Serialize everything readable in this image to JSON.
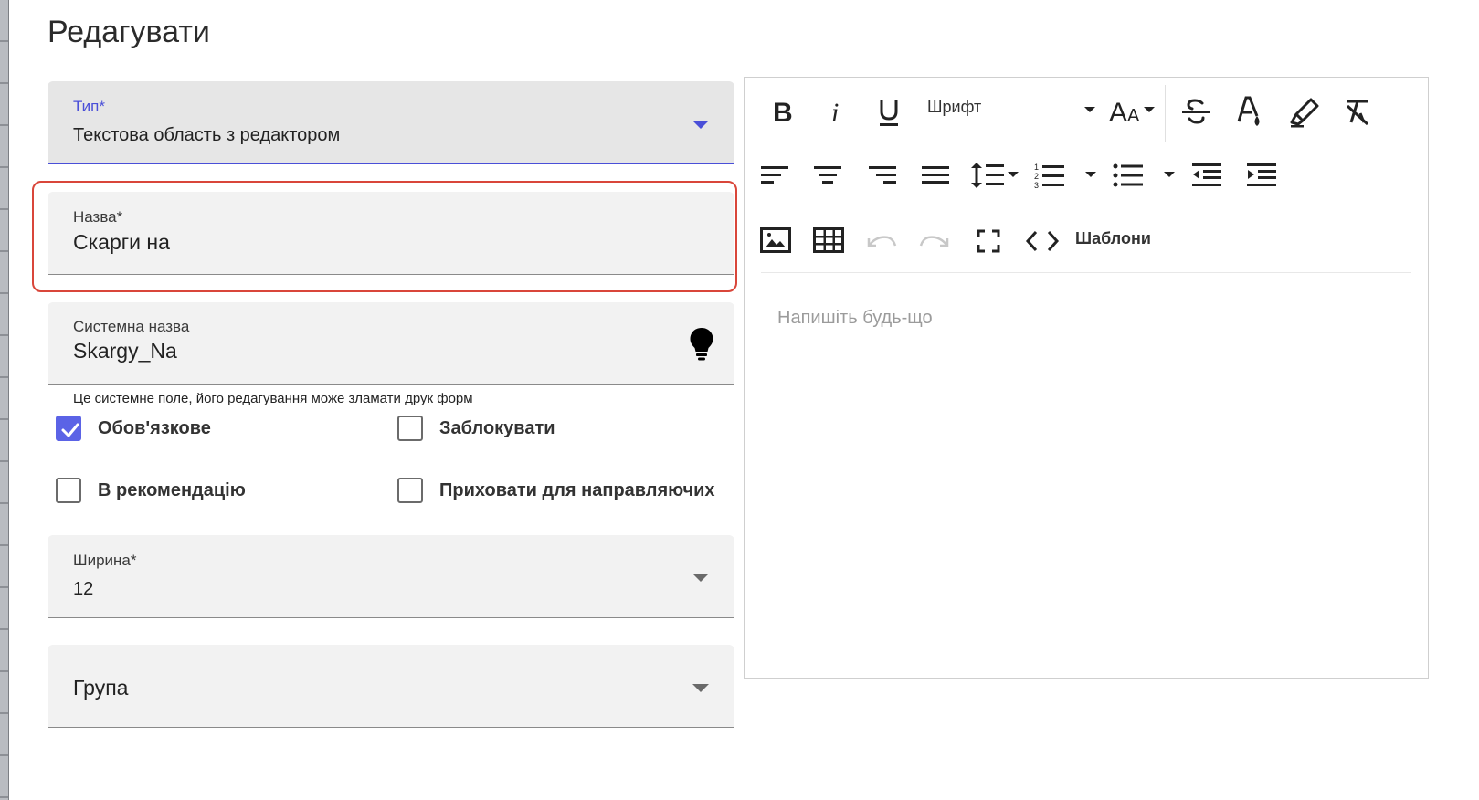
{
  "dialog": {
    "title": "Редагувати"
  },
  "form": {
    "type": {
      "label": "Тип*",
      "value": "Текстова область з редактором"
    },
    "name": {
      "label": "Назва*",
      "value": "Скарги на"
    },
    "system_name": {
      "label": "Системна назва",
      "value": "Skargy_Na",
      "icon": "lightbulb-icon"
    },
    "hint": "Це системне поле, його редагування може зламати друк форм",
    "checkboxes": {
      "required": {
        "label": "Обов'язкове",
        "checked": true
      },
      "lock": {
        "label": "Заблокувати",
        "checked": false
      },
      "recommend": {
        "label": "В рекомендацію",
        "checked": false
      },
      "hide": {
        "label": "Приховати для направляючих",
        "checked": false
      }
    },
    "width": {
      "label": "Ширина*",
      "value": "12"
    },
    "group": {
      "label": "Група",
      "value": ""
    }
  },
  "editor": {
    "font_select": "Шрифт",
    "templates_label": "Шаблони",
    "placeholder": "Напишіть будь-що"
  },
  "colors": {
    "accent": "#4a4fd8",
    "highlight": "#d9463a",
    "checkbox": "#5b63e6"
  }
}
